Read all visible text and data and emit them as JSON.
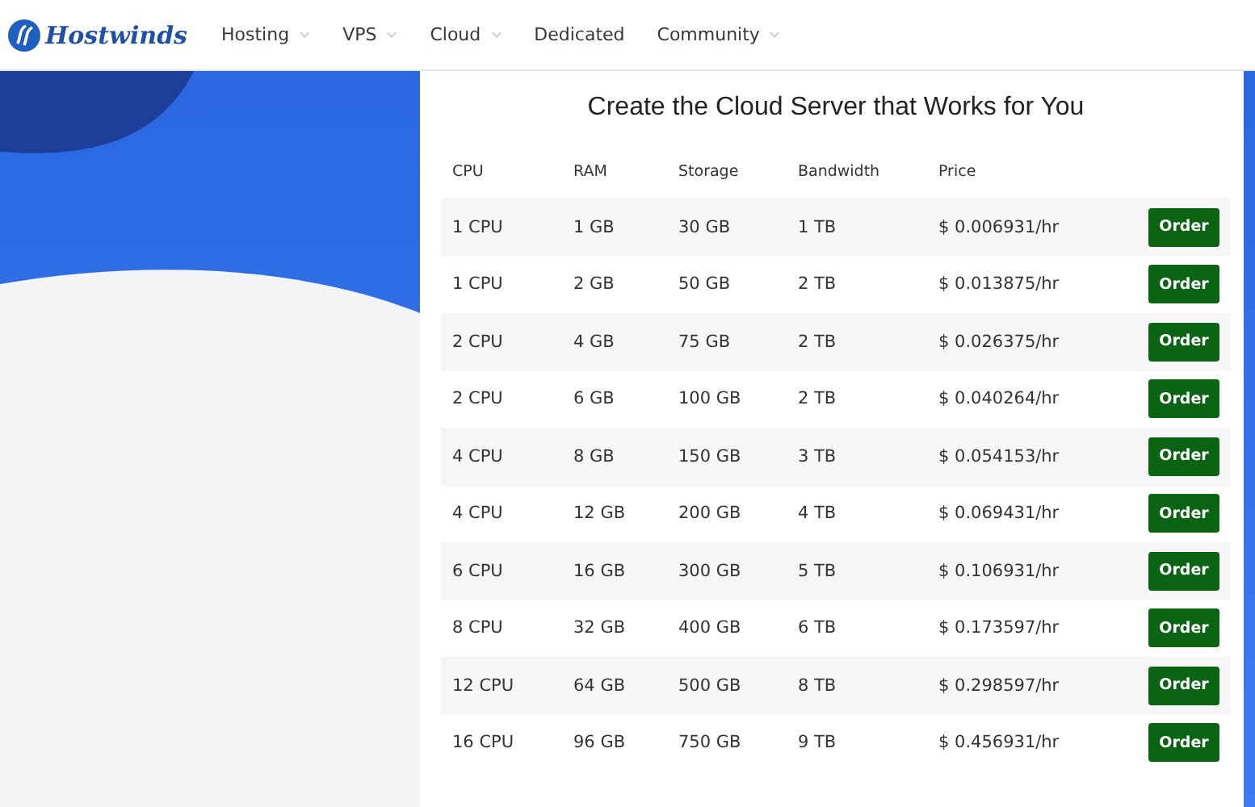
{
  "header": {
    "logo": "Hostwinds",
    "nav": [
      {
        "label": "Hosting",
        "dropdown": true
      },
      {
        "label": "VPS",
        "dropdown": true
      },
      {
        "label": "Cloud",
        "dropdown": true
      },
      {
        "label": "Dedicated",
        "dropdown": false
      },
      {
        "label": "Community",
        "dropdown": true
      }
    ]
  },
  "pricing": {
    "title": "Create the Cloud Server that Works for You",
    "columns": [
      "CPU",
      "RAM",
      "Storage",
      "Bandwidth",
      "Price"
    ],
    "rows": [
      {
        "cells": [
          "1 CPU",
          "1 GB",
          "30 GB",
          "1 TB",
          "$ 0.006931/hr"
        ],
        "action": "Order"
      },
      {
        "cells": [
          "1 CPU",
          "2 GB",
          "50 GB",
          "2 TB",
          "$ 0.013875/hr"
        ],
        "action": "Order"
      },
      {
        "cells": [
          "2 CPU",
          "4 GB",
          "75 GB",
          "2 TB",
          "$ 0.026375/hr"
        ],
        "action": "Order"
      },
      {
        "cells": [
          "2 CPU",
          "6 GB",
          "100 GB",
          "2 TB",
          "$ 0.040264/hr"
        ],
        "action": "Order"
      },
      {
        "cells": [
          "4 CPU",
          "8 GB",
          "150 GB",
          "3 TB",
          "$ 0.054153/hr"
        ],
        "action": "Order"
      },
      {
        "cells": [
          "4 CPU",
          "12 GB",
          "200 GB",
          "4 TB",
          "$ 0.069431/hr"
        ],
        "action": "Order"
      },
      {
        "cells": [
          "6 CPU",
          "16 GB",
          "300 GB",
          "5 TB",
          "$ 0.106931/hr"
        ],
        "action": "Order"
      },
      {
        "cells": [
          "8 CPU",
          "32 GB",
          "400 GB",
          "6 TB",
          "$ 0.173597/hr"
        ],
        "action": "Order"
      },
      {
        "cells": [
          "12 CPU",
          "64 GB",
          "500 GB",
          "8 TB",
          "$ 0.298597/hr"
        ],
        "action": "Order"
      },
      {
        "cells": [
          "16 CPU",
          "96 GB",
          "750 GB",
          "9 TB",
          "$ 0.456931/hr"
        ],
        "action": "Order"
      }
    ]
  }
}
